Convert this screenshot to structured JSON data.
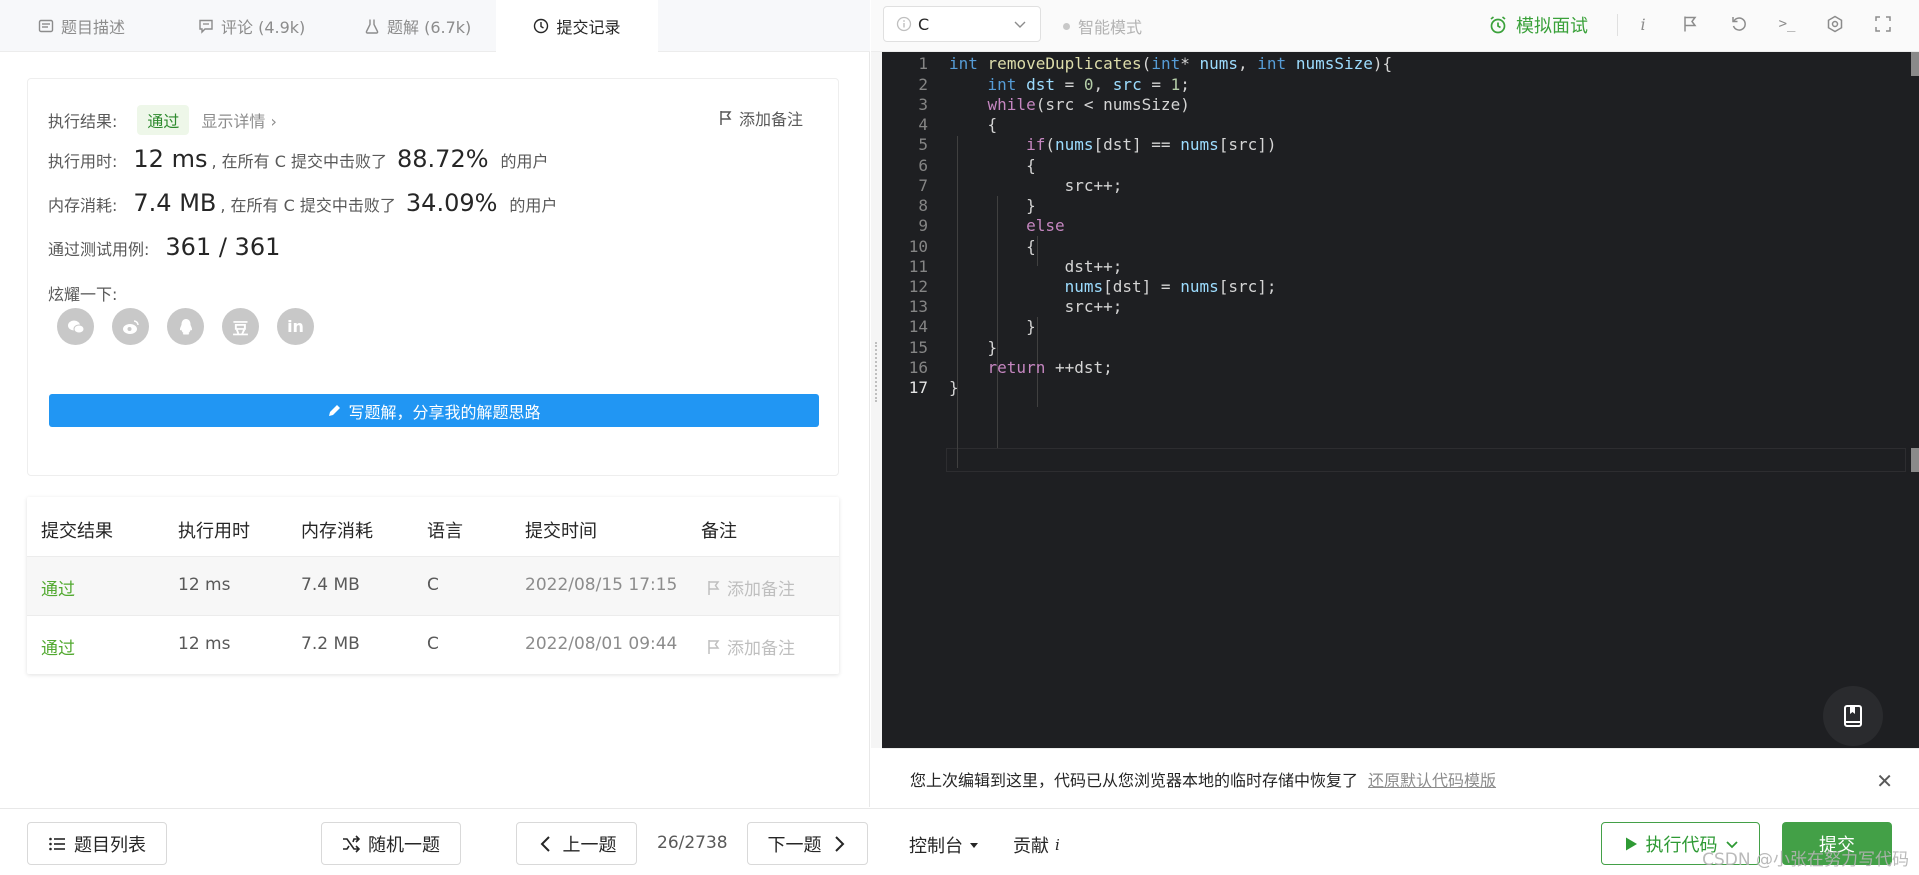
{
  "tabs": [
    {
      "label": "题目描述",
      "icon": "document-icon"
    },
    {
      "label": "评论 (4.9k)",
      "icon": "comment-icon"
    },
    {
      "label": "题解 (6.7k)",
      "icon": "flask-icon"
    },
    {
      "label": "提交记录",
      "icon": "clock-icon",
      "active": true
    }
  ],
  "result": {
    "exec_label": "执行结果:",
    "status": "通过",
    "detail": "显示详情",
    "add_note": "添加备注",
    "time_label": "执行用时:",
    "time_value": "12 ms",
    "time_mid": ", 在所有 C 提交中击败了",
    "time_pct": "88.72%",
    "users": "的用户",
    "mem_label": "内存消耗:",
    "mem_value": "7.4 MB",
    "mem_mid": ", 在所有 C 提交中击败了",
    "mem_pct": "34.09%",
    "cases_label": "通过测试用例:",
    "cases_value": "361 / 361",
    "share_label": "炫耀一下:",
    "share_icons": [
      "wechat-icon",
      "weibo-icon",
      "qq-icon",
      "douban-icon",
      "linkedin-icon"
    ],
    "douban_glyph": "豆",
    "linkedin_glyph": "in",
    "write_solution": "写题解，分享我的解题思路"
  },
  "table": {
    "headers": [
      "提交结果",
      "执行用时",
      "内存消耗",
      "语言",
      "提交时间",
      "备注"
    ],
    "rows": [
      {
        "status": "通过",
        "time": "12 ms",
        "memory": "7.4 MB",
        "lang": "C",
        "submitted": "2022/08/15 17:15",
        "note": "添加备注"
      },
      {
        "status": "通过",
        "time": "12 ms",
        "memory": "7.2 MB",
        "lang": "C",
        "submitted": "2022/08/01 09:44",
        "note": "添加备注"
      }
    ]
  },
  "toolbar": {
    "language": "C",
    "smart_mode": "智能模式",
    "mock_interview": "模拟面试",
    "info_glyph": "i",
    "console_glyph": ">_"
  },
  "editor": {
    "line_numbers": [
      "1",
      "2",
      "3",
      "4",
      "5",
      "6",
      "7",
      "8",
      "9",
      "10",
      "11",
      "12",
      "13",
      "14",
      "15",
      "16",
      "17"
    ],
    "current_line": "17"
  },
  "restore": {
    "message": "您上次编辑到这里，代码已从您浏览器本地的临时存储中恢复了",
    "link": "还原默认代码模版",
    "close": "✕"
  },
  "bottom": {
    "problem_list": "题目列表",
    "random": "随机一题",
    "prev": "上一题",
    "page": "26/2738",
    "next": "下一题",
    "console": "控制台",
    "contribute": "贡献",
    "contribute_glyph": "i",
    "run": "执行代码",
    "submit": "提交"
  },
  "watermark": "CSDN @小张在努力写代码",
  "colors": {
    "accent_blue": "#2196f3",
    "success_green": "#43a047",
    "editor_bg": "#1e1f22"
  }
}
